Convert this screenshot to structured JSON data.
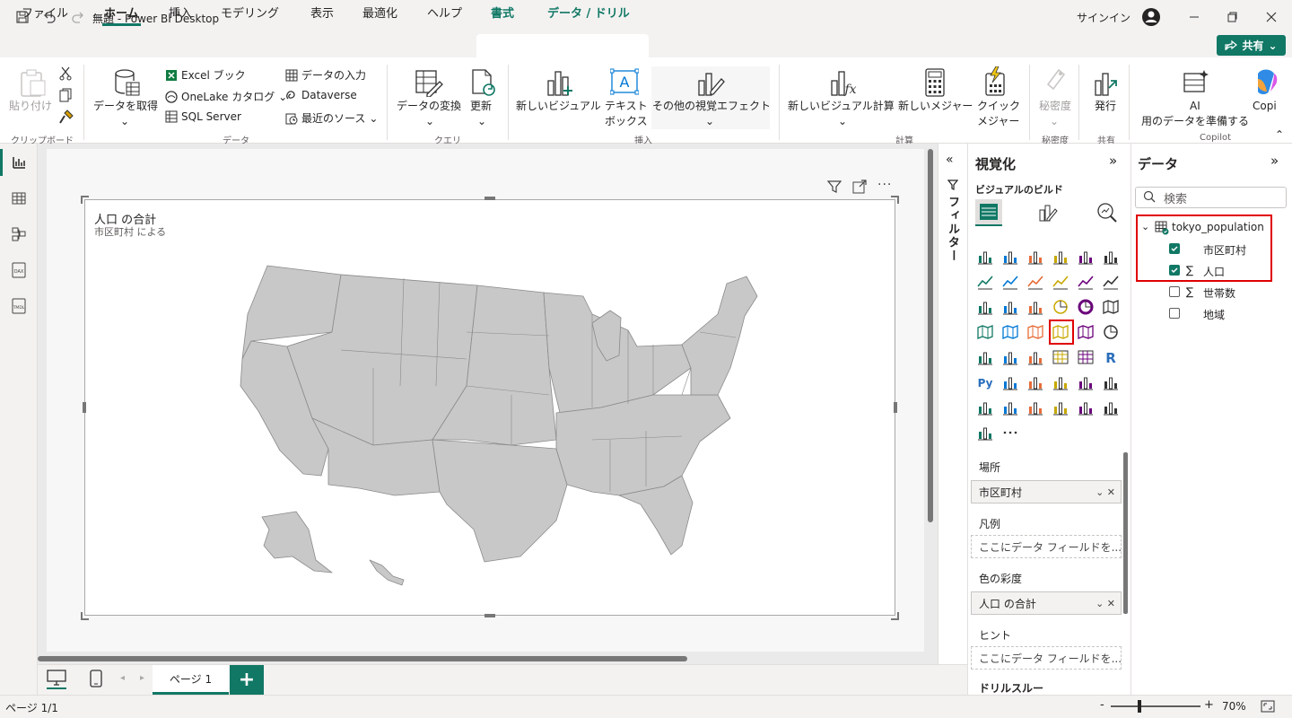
{
  "window": {
    "title": "無題 - Power BI Desktop",
    "signin": "サインイン"
  },
  "menu": {
    "file": "ファイル",
    "home": "ホーム",
    "insert": "挿入",
    "modeling": "モデリング",
    "view": "表示",
    "optimize": "最適化",
    "help": "ヘルプ",
    "format": "書式",
    "data_drill": "データ / ドリル",
    "share": "共有"
  },
  "ribbon": {
    "paste": "貼り付け",
    "clipboard": "クリップボード",
    "get_data": "データを取得",
    "excel": "Excel ブック",
    "onelake": "OneLake カタログ",
    "sql": "SQL Server",
    "enter_data": "データの入力",
    "dataverse": "Dataverse",
    "recent": "最近のソース",
    "data_group": "データ",
    "transform": "データの変換",
    "refresh": "更新",
    "query_group": "クエリ",
    "new_visual": "新しいビジュアル",
    "textbox1": "テキスト",
    "textbox2": "ボックス",
    "more_visuals": "その他の視覚エフェクト",
    "insert_group": "挿入",
    "new_visual_calc": "新しいビジュアル計算",
    "new_measure": "新しいメジャー",
    "quick_measure1": "クイック",
    "quick_measure2": "メジャー",
    "calc_group": "計算",
    "sensitivity": "秘密度",
    "sensitivity_group": "秘密度",
    "publish": "発行",
    "share_group": "共有",
    "ai1": "AI",
    "ai2": "用のデータを準備する",
    "copilot": "Copi",
    "copilot_group": "Copilot"
  },
  "visual": {
    "title": "人口 の合計",
    "subtitle": "市区町村 による"
  },
  "filters": {
    "label": "フィルター"
  },
  "viz": {
    "title": "視覚化",
    "build": "ビジュアルのビルド",
    "wells": [
      {
        "label": "場所",
        "value": "市区町村",
        "filled": true
      },
      {
        "label": "凡例",
        "value": "ここにデータ フィールドを...",
        "filled": false
      },
      {
        "label": "色の彩度",
        "value": "人口 の合計",
        "filled": true
      },
      {
        "label": "ヒント",
        "value": "ここにデータ フィールドを...",
        "filled": false
      },
      {
        "label": "ドリルスルー",
        "value": "",
        "filled": false
      }
    ]
  },
  "data": {
    "title": "データ",
    "search_placeholder": "検索",
    "table": "tokyo_population",
    "fields": [
      {
        "name": "市区町村",
        "checked": true,
        "sigma": false
      },
      {
        "name": "人口",
        "checked": true,
        "sigma": true
      },
      {
        "name": "世帯数",
        "checked": false,
        "sigma": true
      },
      {
        "name": "地域",
        "checked": false,
        "sigma": false
      }
    ]
  },
  "pages": {
    "tab": "ページ 1",
    "add": "+"
  },
  "status": {
    "page": "ページ 1/1",
    "zoom": "70%"
  }
}
